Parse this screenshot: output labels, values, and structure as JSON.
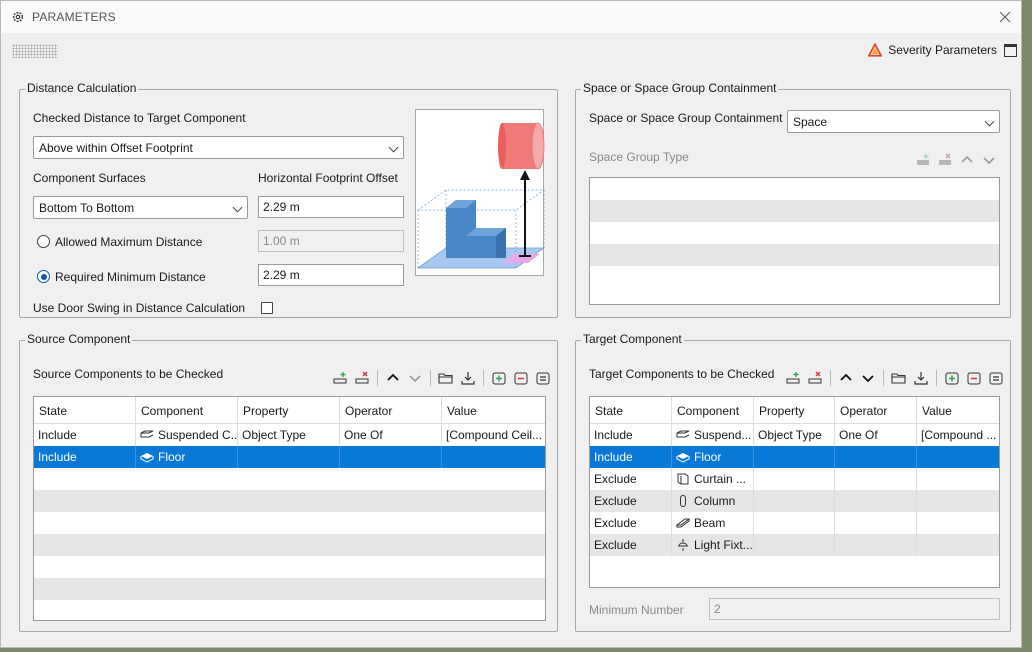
{
  "window": {
    "title": "PARAMETERS",
    "severity_label": "Severity Parameters"
  },
  "distance": {
    "legend": "Distance Calculation",
    "checked_label": "Checked Distance to Target Component",
    "checked_value": "Above within Offset Footprint",
    "surfaces_label": "Component Surfaces",
    "surfaces_value": "Bottom To Bottom",
    "offset_label": "Horizontal Footprint Offset",
    "offset_value": "2.29 m",
    "allowed_max_label": "Allowed Maximum Distance",
    "allowed_max_value": "1.00 m",
    "required_min_label": "Required Minimum Distance",
    "required_min_value": "2.29 m",
    "door_swing_label": "Use Door Swing in Distance Calculation"
  },
  "space": {
    "legend": "Space or Space Group Containment",
    "containment_label": "Space or Space Group Containment",
    "containment_value": "Space",
    "group_type_label": "Space Group Type"
  },
  "source": {
    "legend": "Source Component",
    "list_label": "Source Components to be Checked",
    "columns": [
      "State",
      "Component",
      "Property",
      "Operator",
      "Value"
    ],
    "rows": [
      {
        "state": "Include",
        "component": "Suspended C...",
        "icon": "suspended-ceiling-icon",
        "property": "Object Type",
        "operator": "One Of",
        "value": "[Compound Ceil..."
      },
      {
        "state": "Include",
        "component": "Floor",
        "icon": "floor-icon",
        "property": "",
        "operator": "",
        "value": ""
      }
    ]
  },
  "target": {
    "legend": "Target Component",
    "list_label": "Target Components to be Checked",
    "columns": [
      "State",
      "Component",
      "Property",
      "Operator",
      "Value"
    ],
    "rows": [
      {
        "state": "Include",
        "component": "Suspend...",
        "icon": "suspended-ceiling-icon",
        "property": "Object Type",
        "operator": "One Of",
        "value": "[Compound ..."
      },
      {
        "state": "Include",
        "component": "Floor",
        "icon": "floor-icon",
        "property": "",
        "operator": "",
        "value": ""
      },
      {
        "state": "Exclude",
        "component": "Curtain ...",
        "icon": "curtain-wall-icon",
        "property": "",
        "operator": "",
        "value": ""
      },
      {
        "state": "Exclude",
        "component": "Column",
        "icon": "column-icon",
        "property": "",
        "operator": "",
        "value": ""
      },
      {
        "state": "Exclude",
        "component": "Beam",
        "icon": "beam-icon",
        "property": "",
        "operator": "",
        "value": ""
      },
      {
        "state": "Exclude",
        "component": "Light Fixt...",
        "icon": "light-fixture-icon",
        "property": "",
        "operator": "",
        "value": ""
      }
    ],
    "min_number_label": "Minimum Number",
    "min_number_value": "2"
  },
  "colors": {
    "selection": "#0a78d7",
    "accent_red": "#f07a78",
    "accent_blue": "#4a87c8"
  }
}
